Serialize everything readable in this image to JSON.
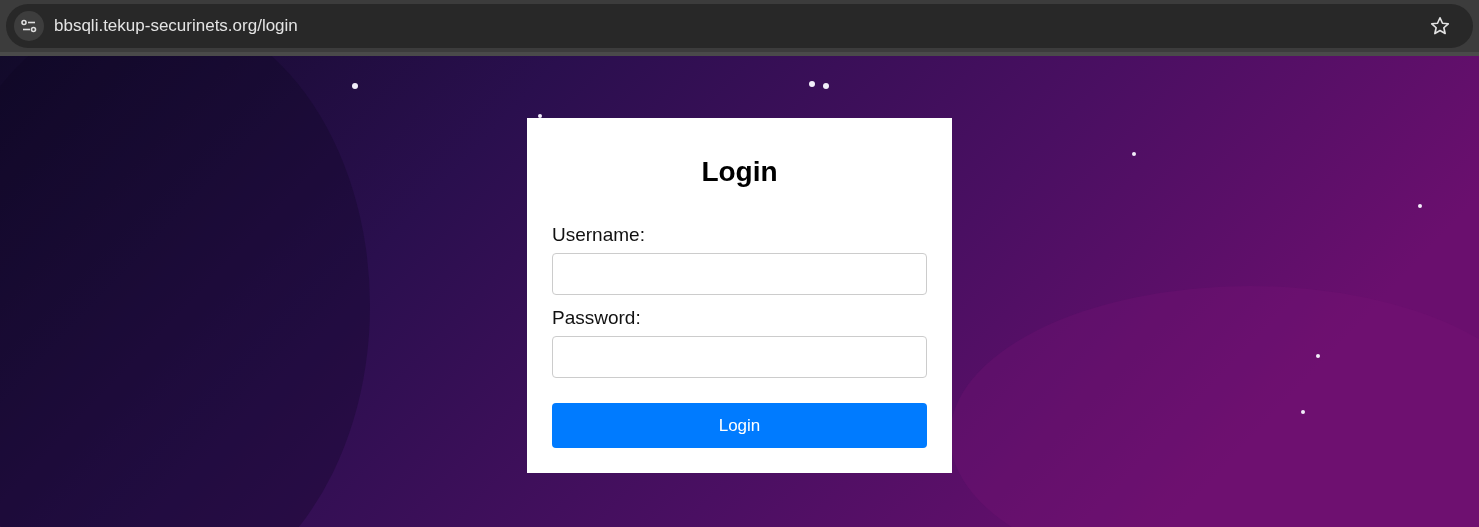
{
  "browser": {
    "url": "bbsqli.tekup-securinets.org/login"
  },
  "login_form": {
    "title": "Login",
    "fields": [
      {
        "label": "Username:"
      },
      {
        "label": "Password:"
      }
    ],
    "submit": "Login"
  }
}
